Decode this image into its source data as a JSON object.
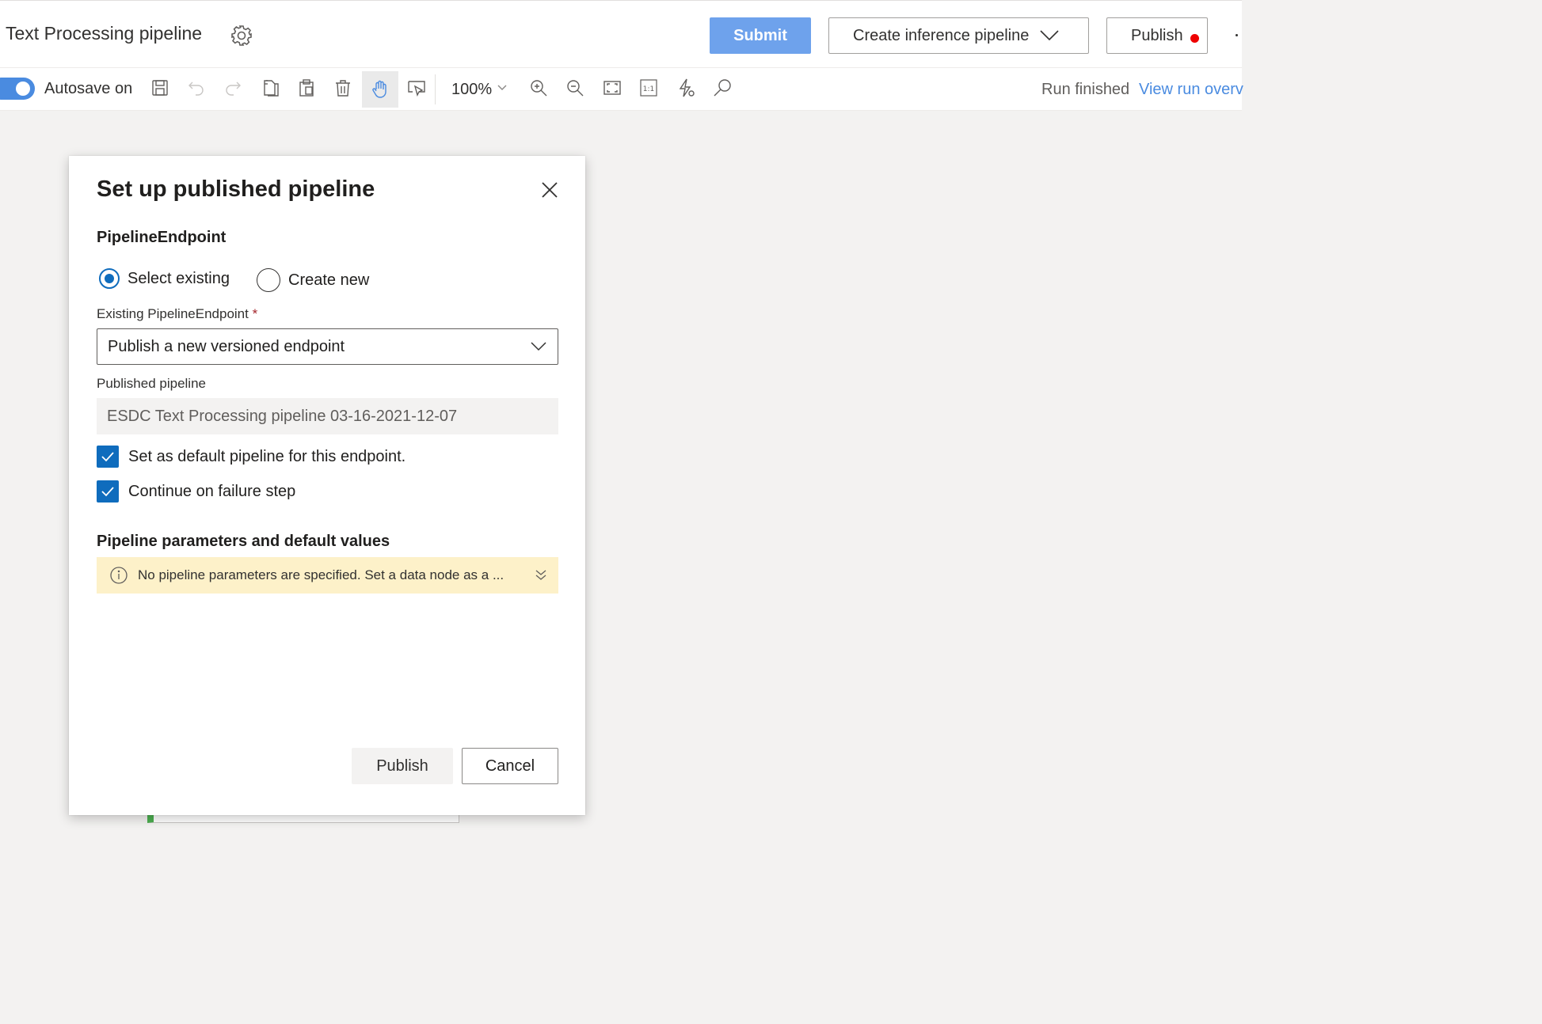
{
  "header": {
    "title": "Text Processing pipeline",
    "submit_label": "Submit",
    "create_inference_label": "Create inference pipeline",
    "publish_label": "Publish",
    "publish_indicator_color": "#e00000"
  },
  "toolbar": {
    "autosave_label": "Autosave on",
    "autosave_enabled": true,
    "zoom": "100%",
    "run_status": "Run finished",
    "view_run_link": "View run overv",
    "icons": [
      "save-icon",
      "undo-icon",
      "redo-icon",
      "copy-icon",
      "paste-icon",
      "delete-icon",
      "pan-hand-icon",
      "select-pointer-icon",
      "zoom-in-icon",
      "zoom-out-icon",
      "fit-screen-icon",
      "actual-size-icon",
      "auto-layout-icon",
      "search-icon"
    ]
  },
  "dialog": {
    "title": "Set up published pipeline",
    "endpoint_section": "PipelineEndpoint",
    "radio_select_existing": "Select existing",
    "radio_create_new": "Create new",
    "selected_option": "Select existing",
    "existing_endpoint_label": "Existing PipelineEndpoint",
    "required_mark": "*",
    "existing_endpoint_value": "Publish a new versioned endpoint",
    "published_pipeline_label": "Published pipeline",
    "published_pipeline_value": "ESDC Text Processing pipeline 03-16-2021-12-07",
    "checkbox_default": "Set as default pipeline for this endpoint.",
    "checkbox_default_checked": true,
    "checkbox_continue": "Continue on failure step",
    "checkbox_continue_checked": true,
    "params_section": "Pipeline parameters and default values",
    "params_info": "No pipeline parameters are specified. Set a data node as a ...",
    "publish_button": "Publish",
    "cancel_button": "Cancel"
  },
  "colors": {
    "accent": "#0f6cbd",
    "submit_bg": "#6ea2ec",
    "info_bg": "#fdf1c9",
    "link": "#4a8be0"
  }
}
